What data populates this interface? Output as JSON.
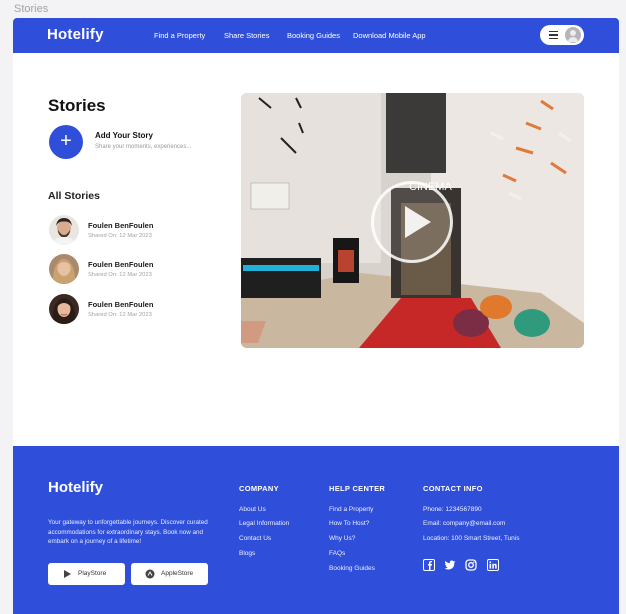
{
  "frame_label": "Stories",
  "header": {
    "logo": "Hotelify",
    "nav": [
      "Find a Property",
      "Share Stories",
      "Booking Guides",
      "Download Mobile App"
    ]
  },
  "main": {
    "title": "Stories",
    "add_story": {
      "title": "Add Your Story",
      "subtitle": "Share your moments, experiences..."
    },
    "all_stories_title": "All Stories",
    "stories": [
      {
        "name": "Foulen BenFoulen",
        "date": "Shared On: 12 Mar 2023"
      },
      {
        "name": "Foulen BenFoulen",
        "date": "Shared On: 12 Mar 2023"
      },
      {
        "name": "Foulen BenFoulen",
        "date": "Shared On: 12 Mar 2023"
      }
    ],
    "video": {
      "sign": "CINEMA"
    }
  },
  "footer": {
    "logo": "Hotelify",
    "tagline": "Your gateway to unforgettable journeys. Discover curated accommodations for extraordinary stays. Book now and embark on a journey of a lifetime!",
    "stores": [
      "PlayStore",
      "AppleStore"
    ],
    "company": {
      "title": "COMPANY",
      "links": [
        "About Us",
        "Legal Information",
        "Contact Us",
        "Blogs"
      ]
    },
    "help": {
      "title": "HELP CENTER",
      "links": [
        "Find a Property",
        "How To Host?",
        "Why Us?",
        "FAQs",
        "Booking Guides"
      ]
    },
    "contact": {
      "title": "CONTACT INFO",
      "lines": [
        "Phone: 1234567890",
        "Email: company@email.com",
        "Location: 100 Smart Street, Tunis"
      ]
    },
    "social_icons": [
      "facebook-icon",
      "twitter-icon",
      "instagram-icon",
      "linkedin-icon"
    ]
  },
  "colors": {
    "brand": "#2f4fdb",
    "background": "#f3f3f5"
  }
}
